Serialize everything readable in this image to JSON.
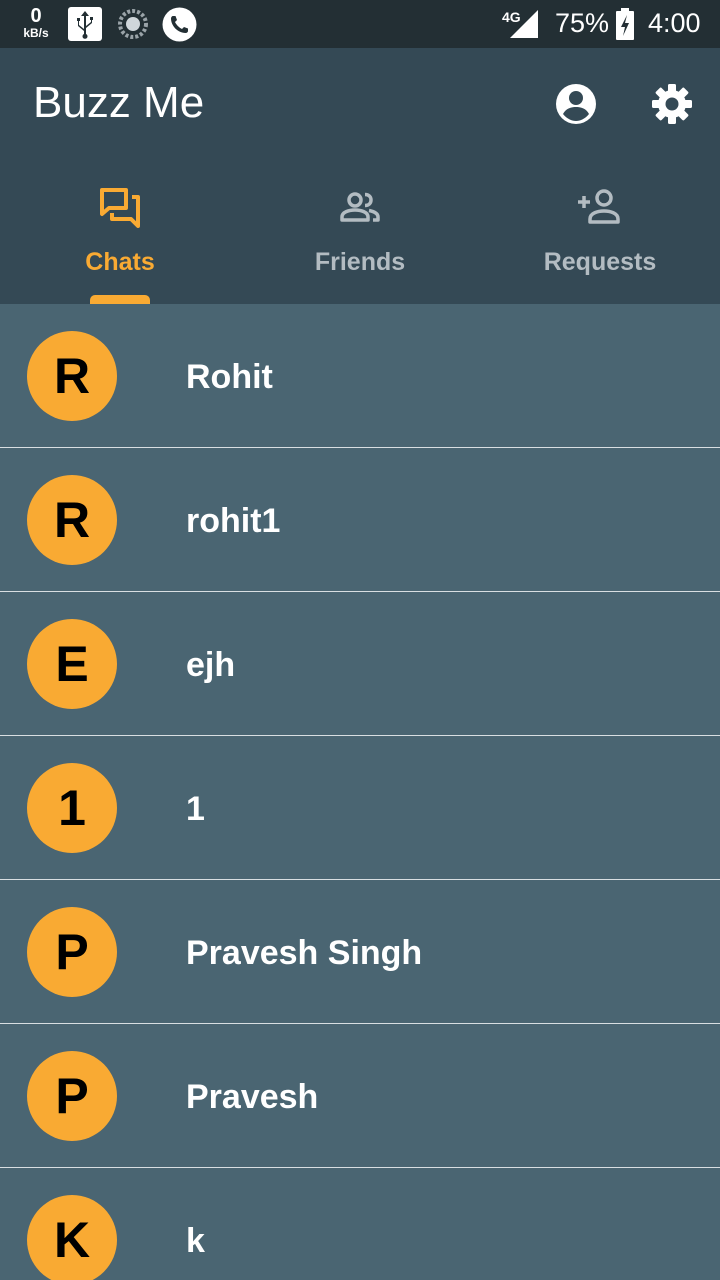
{
  "status_bar": {
    "net_speed_value": "0",
    "net_speed_unit": "kB/s",
    "network_type": "4G",
    "battery_percent": "75%",
    "time": "4:00",
    "icons": [
      "usb-icon",
      "sync-icon",
      "phone-call-icon",
      "signal-icon",
      "battery-charging-icon"
    ]
  },
  "app_bar": {
    "title": "Buzz Me",
    "actions": [
      "account-circle-icon",
      "settings-gear-icon"
    ]
  },
  "tabs": [
    {
      "label": "Chats",
      "icon": "chat-bubbles-icon",
      "selected": true
    },
    {
      "label": "Friends",
      "icon": "people-icon",
      "selected": false
    },
    {
      "label": "Requests",
      "icon": "person-add-icon",
      "selected": false
    }
  ],
  "chats": [
    {
      "initial": "R",
      "name": "Rohit"
    },
    {
      "initial": "R",
      "name": "rohit1"
    },
    {
      "initial": "E",
      "name": "ejh"
    },
    {
      "initial": "1",
      "name": "1"
    },
    {
      "initial": "P",
      "name": "Pravesh Singh"
    },
    {
      "initial": "P",
      "name": "Pravesh"
    },
    {
      "initial": "K",
      "name": "k"
    }
  ],
  "colors": {
    "status_bar": "#232f34",
    "app_bar": "#344955",
    "list_background": "#4a6572",
    "accent": "#f9aa33",
    "inactive_tab": "#b3bcc2",
    "divider": "#d9dfe2"
  }
}
